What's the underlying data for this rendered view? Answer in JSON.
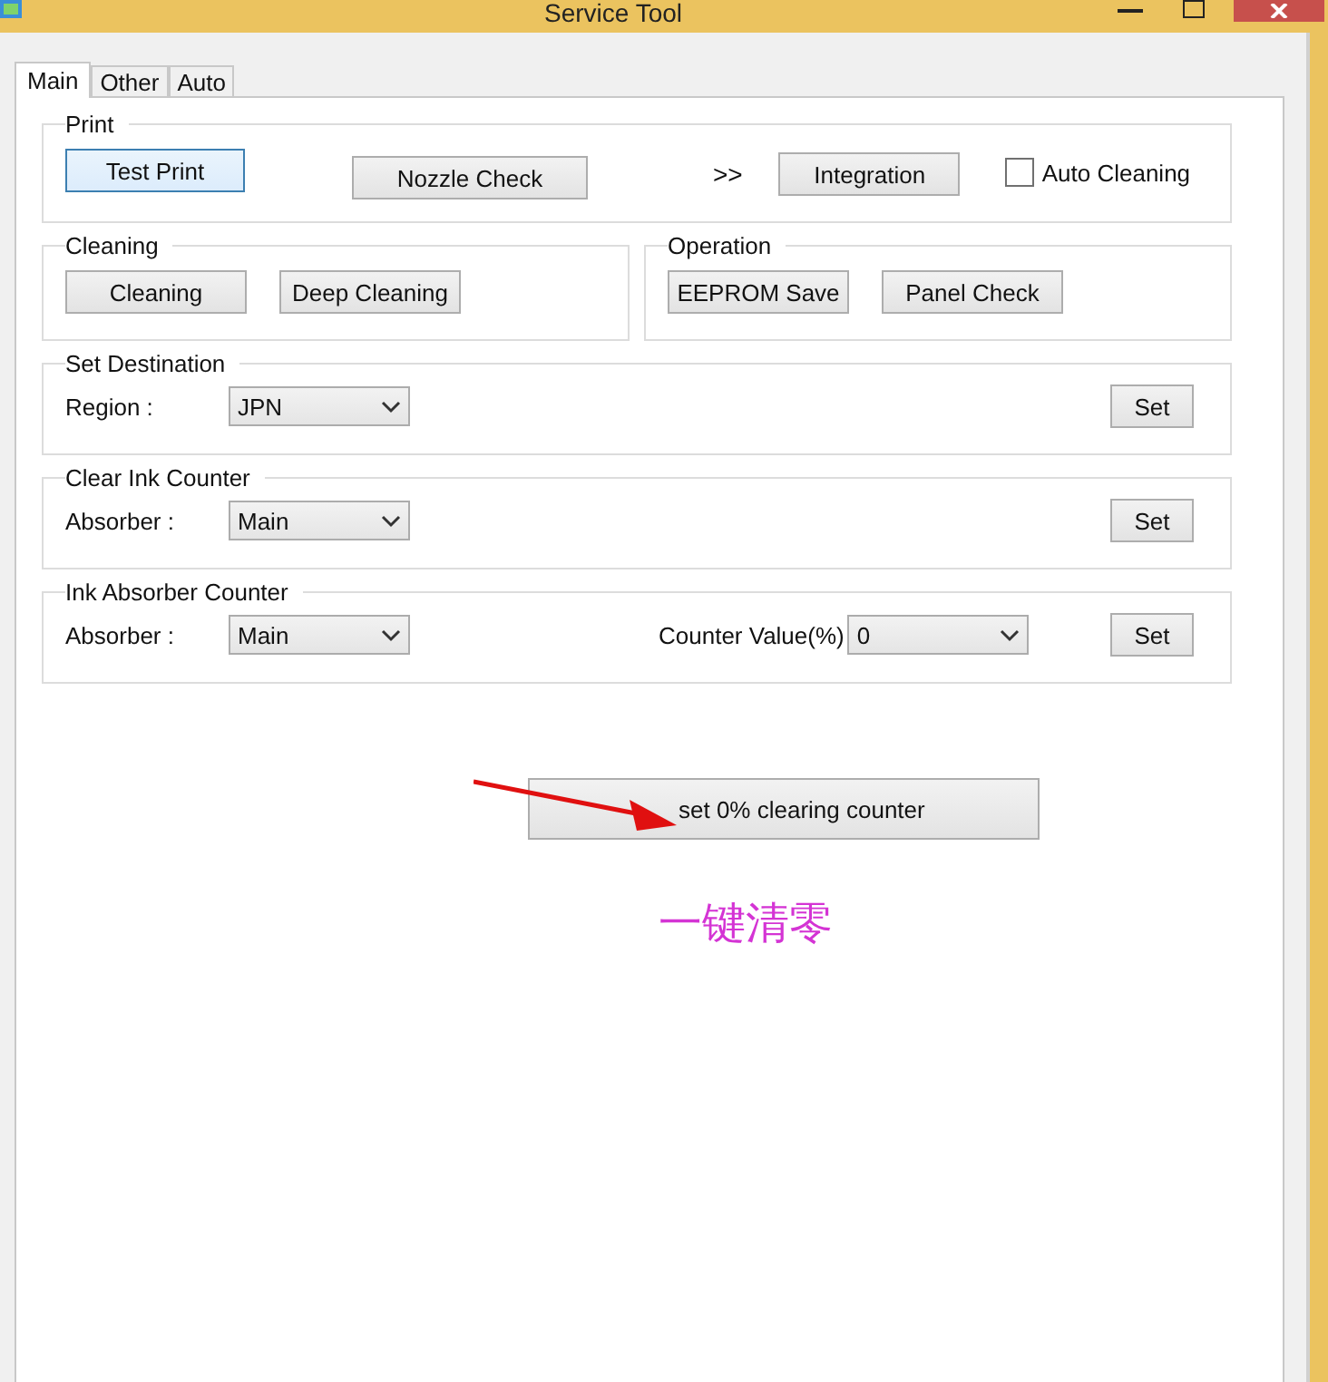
{
  "window": {
    "title": "Service Tool"
  },
  "tabs": [
    {
      "label": "Main",
      "selected": true
    },
    {
      "label": "Other",
      "selected": false
    },
    {
      "label": "Auto",
      "selected": false
    }
  ],
  "print": {
    "title": "Print",
    "test_print": {
      "label": "Test Print",
      "focused": true
    },
    "nozzle_check": {
      "label": "Nozzle Check",
      "focused": false
    },
    "arrows": ">>",
    "integration": {
      "label": "Integration",
      "focused": false
    },
    "auto_cleaning": {
      "label": "Auto Cleaning",
      "checked": false
    }
  },
  "cleaning": {
    "title": "Cleaning",
    "buttons": [
      "Cleaning",
      "Deep Cleaning"
    ]
  },
  "operation": {
    "title": "Operation",
    "buttons": [
      "EEPROM Save",
      "Panel Check"
    ]
  },
  "set_destination": {
    "title": "Set Destination",
    "label": "Region :",
    "value": "JPN",
    "button": "Set"
  },
  "clear_ink_counter": {
    "title": "Clear Ink Counter",
    "label": "Absorber :",
    "value": "Main",
    "button": "Set"
  },
  "ink_absorber_counter": {
    "title": "Ink Absorber Counter",
    "label": "Absorber :",
    "value": "Main",
    "counter_label": "Counter Value(%)",
    "counter_value": "0",
    "button": "Set"
  },
  "clear_button": {
    "label": "set 0% clearing counter"
  },
  "annotation": {
    "text": "一键清零"
  }
}
